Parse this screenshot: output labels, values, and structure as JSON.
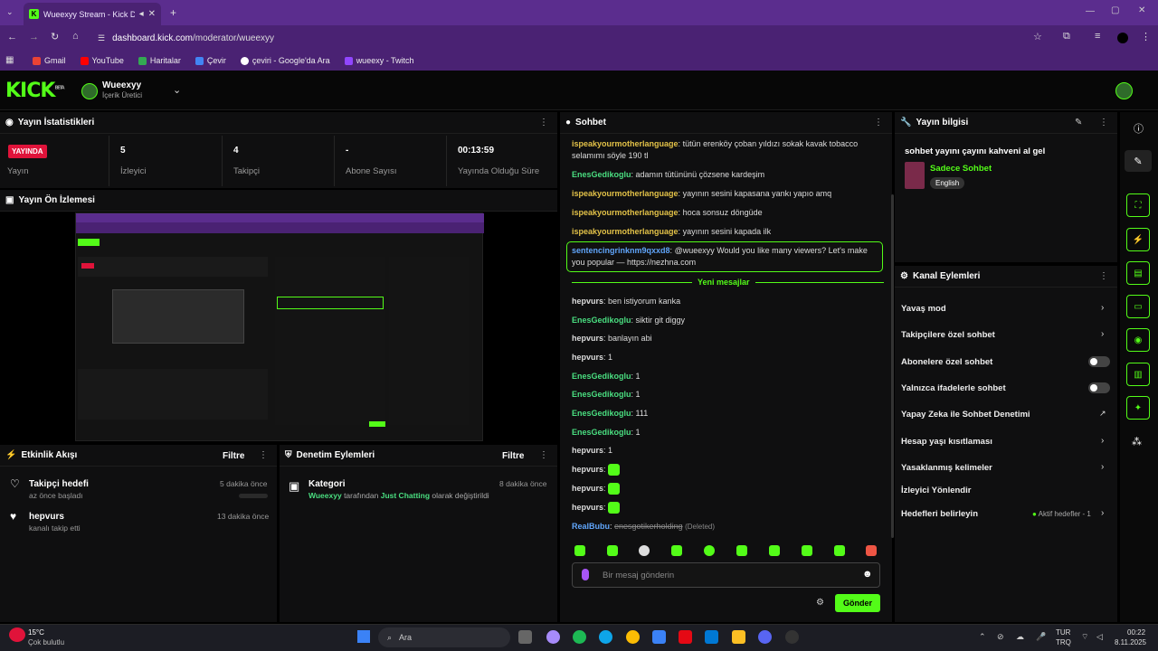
{
  "browser": {
    "tab_title": "Wueexyy Stream - Kick Da",
    "url_host": "dashboard.kick.com",
    "url_path": "/moderator/wueexyy",
    "bookmarks": [
      "Gmail",
      "YouTube",
      "Haritalar",
      "Çevir",
      "çeviri - Google'da Ara",
      "wueexy - Twitch"
    ]
  },
  "header": {
    "logo": "KICK",
    "logo_beta": "BETA",
    "channel_name": "Wueexyy",
    "channel_role": "İçerik Üretici"
  },
  "stats": {
    "title": "Yayın İstatistikleri",
    "live_badge": "YAYINDA",
    "items": [
      {
        "value": "",
        "label": "Yayın"
      },
      {
        "value": "5",
        "label": "İzleyici"
      },
      {
        "value": "4",
        "label": "Takipçi"
      },
      {
        "value": "-",
        "label": "Abone Sayısı"
      },
      {
        "value": "00:13:59",
        "label": "Yayında Olduğu Süre"
      }
    ]
  },
  "preview": {
    "title": "Yayın Ön İzlemesi"
  },
  "activity": {
    "title": "Etkinlik Akışı",
    "filter": "Filtre",
    "items": [
      {
        "name": "Takipçi hedefi",
        "desc": "az önce başladı",
        "time": "5 dakika önce"
      },
      {
        "name": "hepvurs",
        "desc": "kanalı takip etti",
        "time": "13 dakika önce"
      }
    ]
  },
  "modactions": {
    "title": "Denetim Eylemleri",
    "filter": "Filtre",
    "item": {
      "name": "Kategori",
      "time": "8 dakika önce",
      "user": "Wueexyy",
      "mid1": " tarafından ",
      "category": "Just Chatting",
      "mid2": " olarak değiştirildi"
    }
  },
  "chat": {
    "title": "Sohbet",
    "new_messages": "Yeni mesajlar",
    "input_placeholder": "Bir mesaj gönderin",
    "send": "Gönder",
    "messages": [
      {
        "user": "ispeakyourmotherlanguage",
        "text": "tütün erenköy çoban yıldızı sokak kavak tobacco selamımı söyle 190 tl"
      },
      {
        "user": "EnesGedikoglu",
        "text": "adamın tütününü çözsene kardeşim"
      },
      {
        "user": "ispeakyourmotherlanguage",
        "text": "yayının sesini kapasana yankı yapıo amq"
      },
      {
        "user": "ispeakyourmotherlanguage",
        "text": "hoca sonsuz döngüde"
      },
      {
        "user": "ispeakyourmotherlanguage",
        "text": "yayının sesini kapada ilk"
      },
      {
        "user": "sentencingrinknm9qxxd8",
        "text": "@wueexyy Would you like many viewers? Let's make you popular — https://nezhna.com"
      },
      {
        "user": "hepvurs",
        "text": "ben istiyorum kanka"
      },
      {
        "user": "EnesGedikoglu",
        "text": "siktir git diggy"
      },
      {
        "user": "hepvurs",
        "text": "banlayın abi"
      },
      {
        "user": "hepvurs",
        "text": "1"
      },
      {
        "user": "EnesGedikoglu",
        "text": "1"
      },
      {
        "user": "EnesGedikoglu",
        "text": "1"
      },
      {
        "user": "EnesGedikoglu",
        "text": "111"
      },
      {
        "user": "EnesGedikoglu",
        "text": "1"
      },
      {
        "user": "hepvurs",
        "text": "1"
      },
      {
        "user": "hepvurs",
        "text": ""
      },
      {
        "user": "hepvurs",
        "text": ""
      },
      {
        "user": "hepvurs",
        "text": ""
      },
      {
        "user": "RealBubu",
        "text": "enesgotikerholding",
        "deleted": "(Deleted)"
      }
    ]
  },
  "streaminfo": {
    "title": "Yayın bilgisi",
    "stream_title": "sohbet yayını çayını kahveni al gel",
    "category": "Sadece Sohbet",
    "language": "English"
  },
  "channel_actions": {
    "title": "Kanal Eylemleri",
    "items": [
      {
        "label": "Yavaş mod"
      },
      {
        "label": "Takipçilere özel sohbet"
      },
      {
        "label": "Abonelere özel sohbet"
      },
      {
        "label": "Yalnızca ifadelerle sohbet"
      },
      {
        "label": "Yapay Zeka ile Sohbet Denetimi"
      },
      {
        "label": "Hesap yaşı kısıtlaması"
      },
      {
        "label": "Yasaklanmış kelimeler"
      },
      {
        "label": "İzleyici Yönlendir"
      },
      {
        "label": "Hedefleri belirleyin"
      }
    ],
    "goal_status": "Aktif hedefler - 1"
  },
  "taskbar": {
    "weather_temp": "15°C",
    "weather_desc": "Çok bulutlu",
    "search": "Ara",
    "lang1": "TUR",
    "lang2": "TRQ",
    "time": "00:22",
    "date": "8.11.2025"
  },
  "colors": {
    "accent": "#53fc18",
    "live": "#e0133a",
    "browser": "#5b2d8e"
  }
}
